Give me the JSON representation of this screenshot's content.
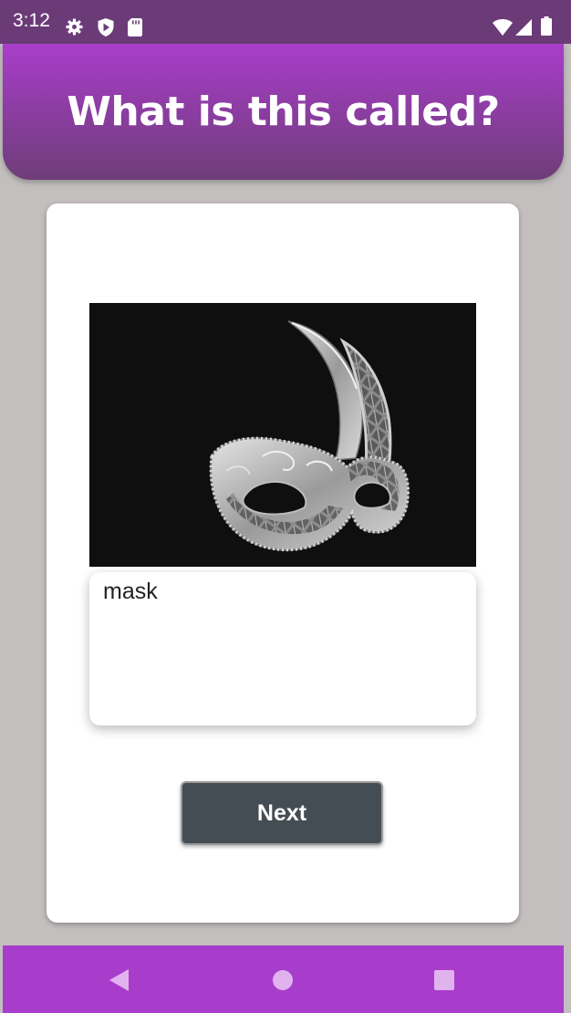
{
  "status_bar": {
    "time": "3:12",
    "left_icons": [
      "gear-icon",
      "shield-play-icon",
      "sd-card-icon"
    ],
    "right_icons": [
      "wifi-icon",
      "cell-signal-icon",
      "battery-icon"
    ],
    "background": "#6b3b78"
  },
  "header": {
    "title": "What is this called?",
    "gradient_top": "#a93dcb",
    "gradient_bottom": "#6e3d78"
  },
  "question": {
    "image_subject": "masquerade mask",
    "answer_value": "mask"
  },
  "actions": {
    "next_label": "Next",
    "button_color": "#454d54"
  },
  "nav_bar": {
    "buttons": [
      "back-icon",
      "home-icon",
      "recents-icon"
    ],
    "background": "#a93dcb"
  }
}
